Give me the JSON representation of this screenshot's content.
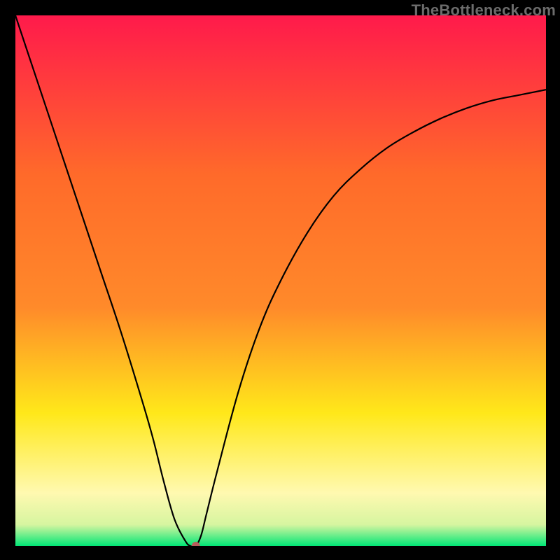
{
  "watermark": "TheBottleneck.com",
  "chart_data": {
    "type": "line",
    "title": "",
    "xlabel": "",
    "ylabel": "",
    "xlim": [
      0,
      100
    ],
    "ylim": [
      0,
      100
    ],
    "background_gradient": {
      "top_color": "#ff1a4b",
      "mid_upper_color": "#ff8a2a",
      "mid_color": "#ffe81a",
      "lower_color": "#fff9b0",
      "bottom_color": "#00e676"
    },
    "series": [
      {
        "name": "bottleneck-curve",
        "color": "#000000",
        "x": [
          0,
          4,
          8,
          12,
          16,
          20,
          24,
          26,
          28,
          30,
          32,
          33,
          34,
          35,
          36,
          38,
          42,
          46,
          50,
          55,
          60,
          65,
          70,
          75,
          80,
          85,
          90,
          95,
          100
        ],
        "values": [
          100,
          88,
          76,
          64,
          52,
          40,
          27,
          20,
          12,
          5,
          1,
          0,
          0,
          2,
          6,
          14,
          29,
          41,
          50,
          59,
          66,
          71,
          75,
          78,
          80.5,
          82.5,
          84,
          85,
          86
        ]
      }
    ],
    "marker": {
      "name": "optimal-point",
      "x": 34,
      "y_value": 0,
      "color": "#b85c5c",
      "radius": 6
    }
  }
}
